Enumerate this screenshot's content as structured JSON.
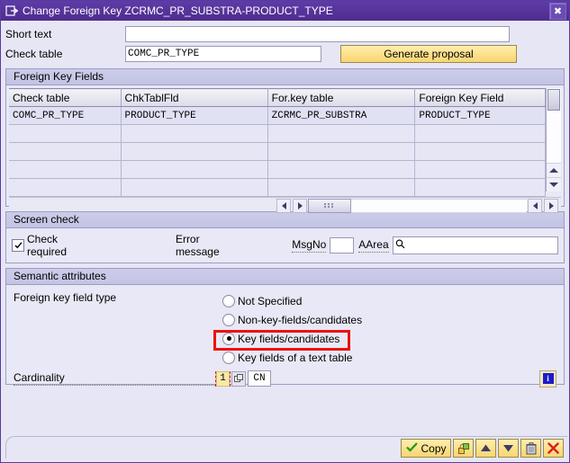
{
  "window": {
    "title": "Change Foreign Key ZCRMC_PR_SUBSTRA-PRODUCT_TYPE",
    "title_icon": "dialog-icon",
    "close_label": "✖"
  },
  "form": {
    "short_text_label": "Short text",
    "short_text_value": "",
    "short_text_placeholder": "",
    "check_table_label": "Check table",
    "check_table_value": "COMC_PR_TYPE",
    "generate_proposal_label": "Generate proposal"
  },
  "foreign_key_fields": {
    "group_title": "Foreign Key Fields",
    "columns": [
      "Check table",
      "ChkTablFld",
      "For.key table",
      "Foreign Key Field"
    ],
    "rows": [
      [
        "COMC_PR_TYPE",
        "PRODUCT_TYPE",
        "ZCRMC_PR_SUBSTRA",
        "PRODUCT_TYPE"
      ],
      [
        "",
        "",
        "",
        ""
      ],
      [
        "",
        "",
        "",
        ""
      ],
      [
        "",
        "",
        "",
        ""
      ],
      [
        "",
        "",
        "",
        ""
      ]
    ]
  },
  "screen_check": {
    "group_title": "Screen check",
    "check_required_label": "Check required",
    "check_required_checked": true,
    "error_message_label": "Error message",
    "msgno_label": "MsgNo",
    "msgno_value": "",
    "aarea_label": "AArea",
    "aarea_value": "",
    "aarea_icon": "search-icon"
  },
  "semantic_attributes": {
    "group_title": "Semantic attributes",
    "field_type_label": "Foreign key field type",
    "options": [
      {
        "label": "Not Specified",
        "selected": false
      },
      {
        "label": "Non-key-fields/candidates",
        "selected": false
      },
      {
        "label": "Key fields/candidates",
        "selected": true
      },
      {
        "label": "Key fields of a text table",
        "selected": false
      }
    ],
    "cardinality_label": "Cardinality",
    "cardinality_left_value": "1",
    "cardinality_right_value": "CN",
    "info_icon_label": "i"
  },
  "footer": {
    "copy_label": "Copy",
    "buttons": [
      {
        "name": "copy-entry-button",
        "icon": "copy-icon"
      },
      {
        "name": "scroll-up-button",
        "icon": "arrow-up-icon"
      },
      {
        "name": "scroll-down-button",
        "icon": "arrow-down-icon"
      },
      {
        "name": "delete-button",
        "icon": "trash-icon"
      },
      {
        "name": "cancel-button",
        "icon": "red-x-icon"
      }
    ]
  },
  "colors": {
    "titlebar": "#563399",
    "accent_yellow": "#fde08a",
    "annotation_red": "#ee1111",
    "panel": "#e6e6f5"
  }
}
